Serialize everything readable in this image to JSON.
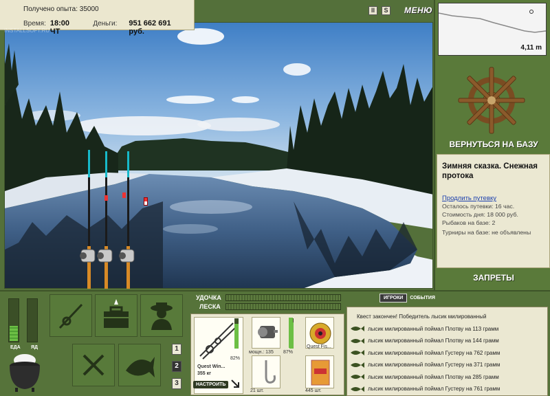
{
  "header": {
    "exp_label": "Получено опыта:",
    "exp_value": "35000",
    "time_label": "Время:",
    "time_value": "18:00 ЧТ",
    "money_label": "Деньги:",
    "money_value": "951 662 691 руб.",
    "watermark": "INSTALLSOFT.RU"
  },
  "controls": {
    "pause": "II",
    "speed": "S",
    "menu": "МЕНЮ"
  },
  "depth": {
    "value": "4,11 m"
  },
  "nav": {
    "return_base": "ВЕРНУТЬСЯ НА БАЗУ",
    "bans": "ЗАПРЕТЫ"
  },
  "location": {
    "title": "Зимняя сказка. Снежная протока",
    "extend_link": "Продлить путевку",
    "lines": [
      "Осталось путевки: 16 час.",
      "Стоимость дня: 18 000 руб.",
      "Рыбаков на базе: 2",
      "Турниры на базе: не объявлены"
    ]
  },
  "status": {
    "food_label": "ЕДА",
    "poison_label": "ЯД",
    "food_level": 0.35,
    "poison_level": 0.0
  },
  "pages": [
    "1",
    "2",
    "3"
  ],
  "tackle": {
    "rod_label": "УДОЧКА",
    "line_label": "ЛЕСКА",
    "rod_name": "Quest Win...",
    "rod_load": "355 кг",
    "rod_percent": "82%",
    "reel_caption": "мощн.: 135",
    "reel_percent": "87%",
    "line_name": "Quest Fis...",
    "hook_count": "21 шт.",
    "bait_count": "445 шт.",
    "tune_button": "НАСТРОИТЬ",
    "rod_level": 0.82,
    "reel_level": 0.87
  },
  "events": {
    "tabs": {
      "players": "ИГРОКИ",
      "events": "СОБЫТИЯ"
    },
    "items": [
      "Квест закончен! Победитель лысик милированный",
      "лысик милированный поймал Плотву на 113 грамм",
      "лысик милированный поймал Плотву на 144 грамм",
      "лысик милированный поймал Густеру на 762 грамм",
      "лысик милированный поймал Густеру на 371 грамм",
      "лысик милированный поймал Плотву на 285 грамм",
      "лысик милированный поймал Густеру на 761 грамм"
    ]
  },
  "colors": {
    "panel_green": "#56733a",
    "panel_cream": "#ebe8d2",
    "level_green": "#6cbf45"
  }
}
